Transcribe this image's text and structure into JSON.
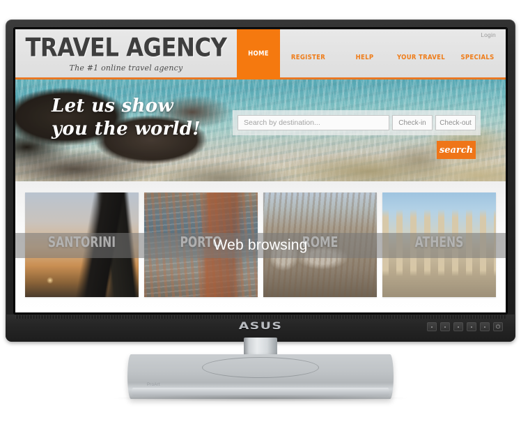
{
  "website": {
    "brand": {
      "title": "TRAVEL AGENCY",
      "tagline": "The #1 online travel agency"
    },
    "login_label": "Login",
    "nav": [
      {
        "label": "HOME",
        "active": true
      },
      {
        "label": "REGISTER",
        "active": false
      },
      {
        "label": "HELP",
        "active": false
      },
      {
        "label": "YOUR TRAVEL",
        "active": false
      },
      {
        "label": "SPECIALS",
        "active": false
      }
    ],
    "hero": {
      "headline_line1": "Let us show",
      "headline_line2": "you the world!",
      "search": {
        "destination_placeholder": "Search by destination...",
        "destination_value": "",
        "checkin_label": "Check-in",
        "checkout_label": "Check-out",
        "button_label": "search"
      }
    },
    "destinations": [
      {
        "label": "SANTORINI"
      },
      {
        "label": "PORTO"
      },
      {
        "label": "ROME"
      },
      {
        "label": "ATHENS"
      }
    ],
    "colors": {
      "accent_orange": "#f5790f",
      "nav_orange": "#ef7d1a",
      "header_grey": "#e3e3e3",
      "login_grey": "#9a9a9a"
    }
  },
  "overlay": {
    "caption": "Web browsing"
  },
  "monitor": {
    "brand_logo": "ASUS",
    "stand_mark": "ProArt",
    "osd_buttons": [
      {
        "name": "osd-button-1",
        "glyph": ""
      },
      {
        "name": "osd-button-2",
        "glyph": ""
      },
      {
        "name": "osd-button-3",
        "glyph": ""
      },
      {
        "name": "osd-button-4",
        "glyph": ""
      },
      {
        "name": "osd-button-5",
        "glyph": ""
      }
    ],
    "power_button_glyph": "⏻"
  }
}
